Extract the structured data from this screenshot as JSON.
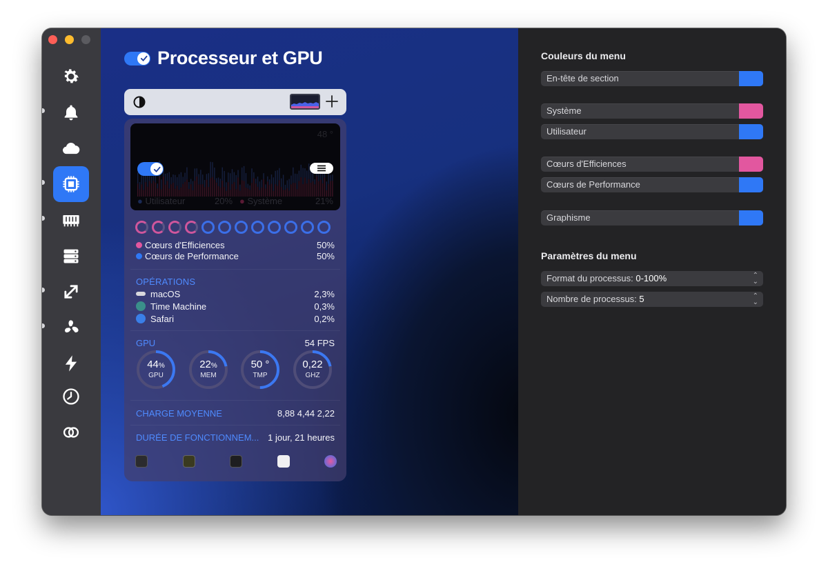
{
  "window": {
    "title": "Processeur et GPU"
  },
  "sidebar": {
    "items": [
      {
        "icon": "gear-icon"
      },
      {
        "icon": "bell-icon"
      },
      {
        "icon": "cloud-icon"
      },
      {
        "icon": "cpu-icon",
        "active": true
      },
      {
        "icon": "memory-icon"
      },
      {
        "icon": "disk-icon"
      },
      {
        "icon": "network-icon"
      },
      {
        "icon": "fan-icon"
      },
      {
        "icon": "battery-icon"
      },
      {
        "icon": "clock-icon"
      },
      {
        "icon": "rings-icon"
      }
    ]
  },
  "main": {
    "title": "Processeur et GPU",
    "title_toggle_on": true
  },
  "preview": {
    "chart": {
      "temp": "48 °",
      "user_label": "Utilisateur",
      "user_value": "20%",
      "system_label": "Système",
      "system_value": "21%"
    },
    "cores": {
      "efficiency_label": "Cœurs d'Efficiences",
      "efficiency_value": "50%",
      "performance_label": "Cœurs de Performance",
      "performance_value": "50%"
    },
    "operations": {
      "heading": "OPÉRATIONS",
      "rows": [
        {
          "name": "macOS",
          "value": "2,3%"
        },
        {
          "name": "Time Machine",
          "value": "0,3%"
        },
        {
          "name": "Safari",
          "value": "0,2%"
        }
      ]
    },
    "gpu": {
      "heading": "GPU",
      "fps": "54 FPS",
      "gauges": [
        {
          "value": "44",
          "unit": "%",
          "caption": "GPU",
          "fraction": 0.44
        },
        {
          "value": "22",
          "unit": "%",
          "caption": "MEM",
          "fraction": 0.22
        },
        {
          "value": "50 °",
          "unit": "",
          "caption": "TMP",
          "fraction": 0.5
        },
        {
          "value": "0,22",
          "unit": "",
          "caption": "GHZ",
          "fraction": 0.22
        }
      ]
    },
    "load": {
      "label": "CHARGE MOYENNE",
      "value": "8,88 4,44 2,22"
    },
    "uptime": {
      "label": "DURÉE DE FONCTIONNEM...",
      "value": "1 jour, 21 heures"
    }
  },
  "settings": {
    "colors_heading": "Couleurs du menu",
    "colors": [
      {
        "label": "En-tête de section",
        "color": "#2f78f6"
      },
      {
        "label": "Système",
        "color": "#e2579f"
      },
      {
        "label": "Utilisateur",
        "color": "#2f78f6"
      },
      {
        "label": "Cœurs d'Efficiences",
        "color": "#e2579f"
      },
      {
        "label": "Cœurs de Performance",
        "color": "#2f78f6"
      },
      {
        "label": "Graphisme",
        "color": "#2f78f6"
      }
    ],
    "params_heading": "Paramètres du menu",
    "params": [
      {
        "label": "Format du processus:",
        "value": "0-100%"
      },
      {
        "label": "Nombre de processus:",
        "value": "5"
      }
    ]
  }
}
